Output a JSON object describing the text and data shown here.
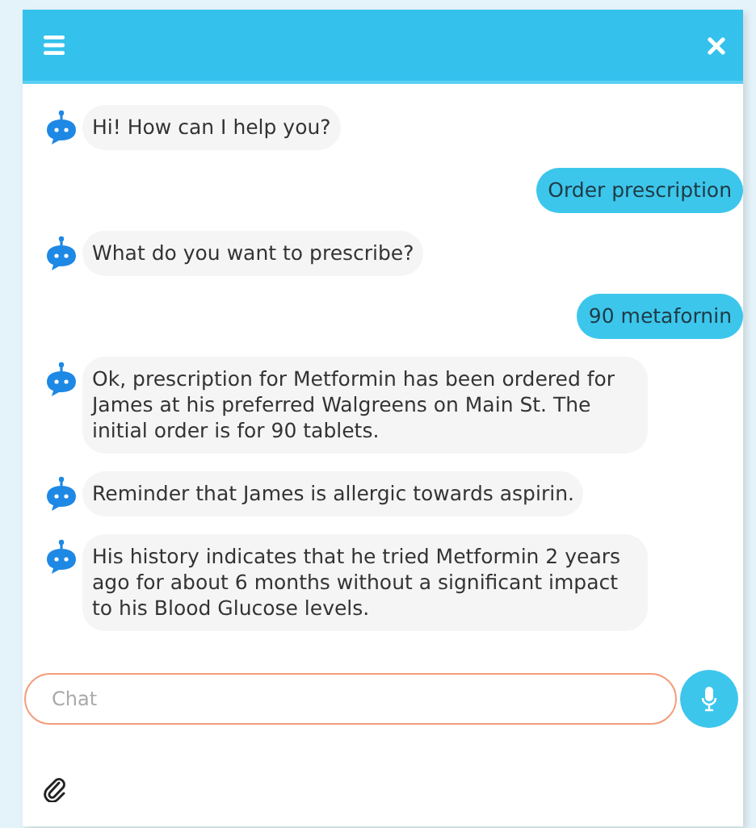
{
  "messages": [
    {
      "kind": "bot",
      "text": "Hi! How can I help you?"
    },
    {
      "kind": "user",
      "text": "Order prescription"
    },
    {
      "kind": "bot",
      "text": "What do you want to prescribe?"
    },
    {
      "kind": "user",
      "text": "90 metafornin"
    },
    {
      "kind": "bot",
      "text": "Ok, prescription for Metformin has been ordered for James at his preferred Walgreens on Main St. The initial order is for 90 tablets."
    },
    {
      "kind": "bot",
      "text": "Reminder that James is allergic towards aspirin."
    },
    {
      "kind": "bot",
      "text": "His history indicates that he tried Metformin 2 years ago for about 6 months without a significant impact to his Blood Glucose levels."
    }
  ],
  "input": {
    "placeholder": "Chat"
  }
}
